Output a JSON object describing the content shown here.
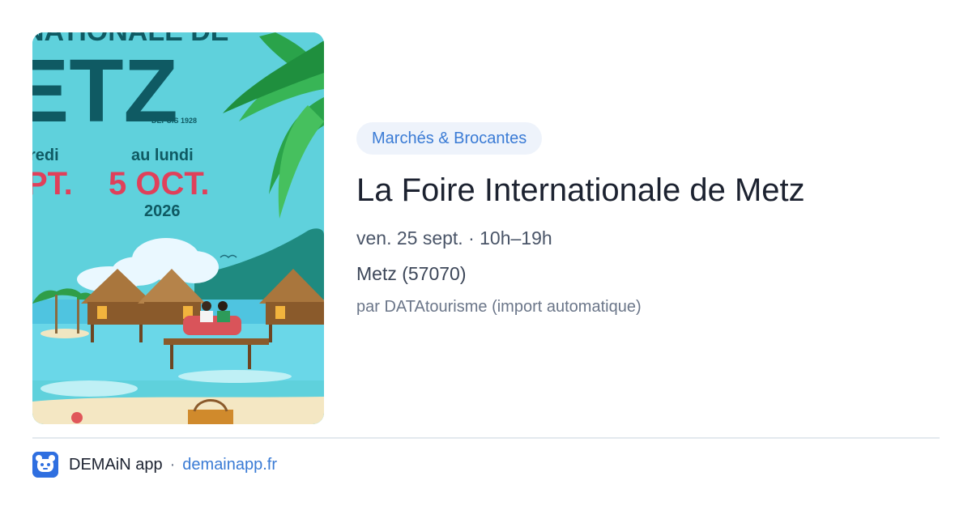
{
  "poster": {
    "title_fragment": "NATIONALE DE",
    "city": "ETZ",
    "since": "DEPUIS 1928",
    "from_day": "redi",
    "to_day": "au lundi",
    "from_date": "PT.",
    "to_date": "5 OCT.",
    "year": "2026"
  },
  "event": {
    "category": "Marchés & Brocantes",
    "title": "La Foire Internationale de Metz",
    "datetime": "ven. 25 sept. · 10h–19h",
    "location": "Metz (57070)",
    "source": "par DATAtourisme (import automatique)"
  },
  "footer": {
    "app_name": "DEMAiN app",
    "separator": "·",
    "site": "demainapp.fr"
  }
}
